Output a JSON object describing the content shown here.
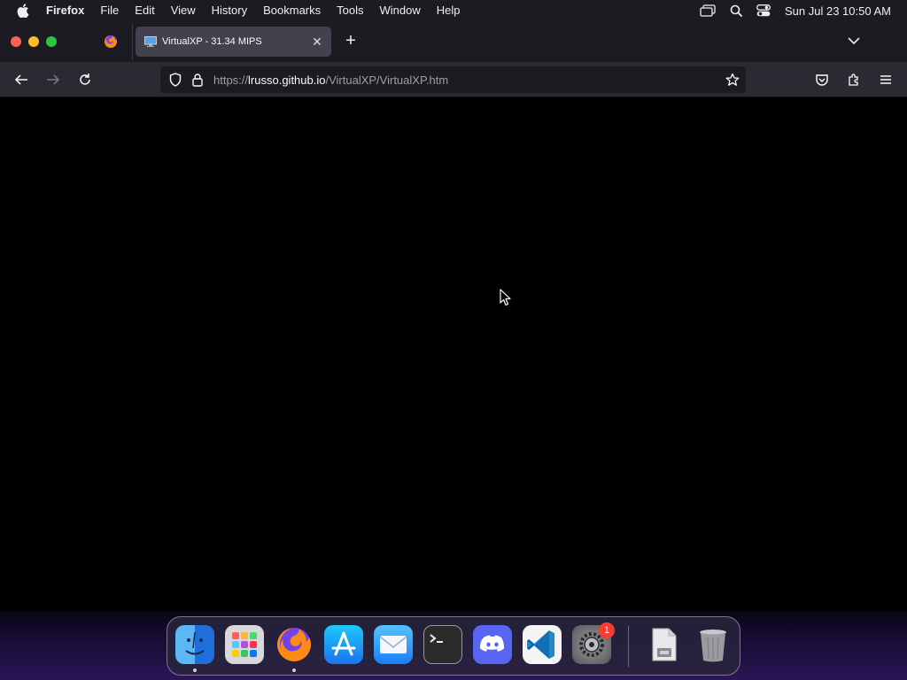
{
  "menubar": {
    "app_name": "Firefox",
    "items": [
      "File",
      "Edit",
      "View",
      "History",
      "Bookmarks",
      "Tools",
      "Window",
      "Help"
    ],
    "clock": "Sun Jul 23  10:50 AM"
  },
  "tabs": {
    "active_title": "VirtualXP - 31.34 MIPS"
  },
  "urlbar": {
    "scheme": "https://",
    "host": "lrusso.github.io",
    "path": "/VirtualXP/VirtualXP.htm"
  },
  "dock": {
    "apps": [
      {
        "name": "Finder",
        "icon": "finder-icon",
        "running": true
      },
      {
        "name": "Launchpad",
        "icon": "launchpad-icon",
        "running": false
      },
      {
        "name": "Firefox",
        "icon": "firefox-icon",
        "running": true
      },
      {
        "name": "App Store",
        "icon": "app-store-icon",
        "running": false
      },
      {
        "name": "Mail",
        "icon": "mail-icon",
        "running": false
      },
      {
        "name": "Terminal",
        "icon": "terminal-icon",
        "running": false
      },
      {
        "name": "Discord",
        "icon": "discord-icon",
        "running": false
      },
      {
        "name": "Visual Studio Code",
        "icon": "vscode-icon",
        "running": false
      },
      {
        "name": "System Settings",
        "icon": "settings-icon",
        "running": false,
        "badge": "1"
      }
    ],
    "extras": [
      {
        "name": "Document",
        "icon": "document-icon"
      },
      {
        "name": "Trash",
        "icon": "trash-icon"
      }
    ]
  },
  "colors": {
    "menubar_bg": "#1c1b22",
    "toolbar_bg": "#2b2a33",
    "active_tab_bg": "#42414d",
    "content_bg": "#000000",
    "badge": "#ff3b30"
  }
}
